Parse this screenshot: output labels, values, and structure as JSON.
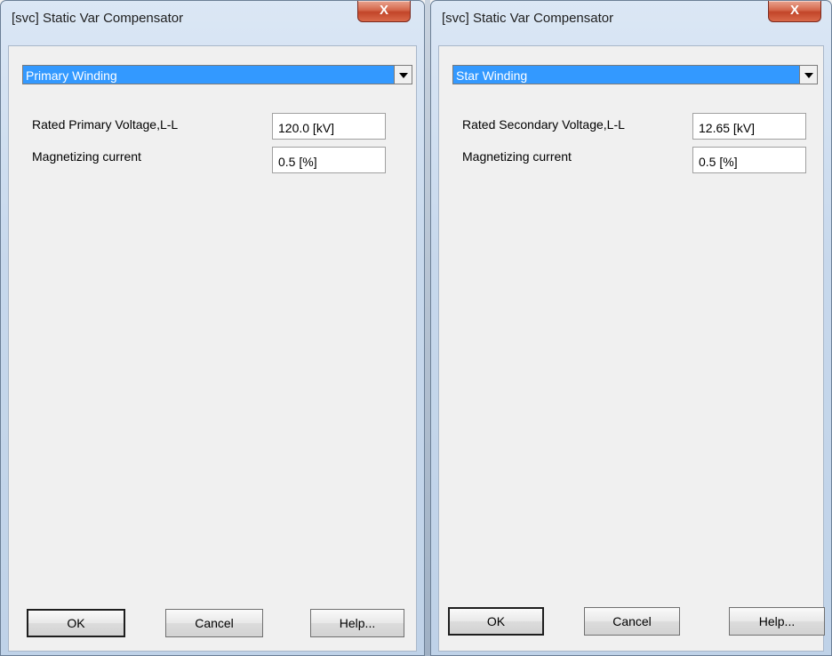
{
  "dialogs": [
    {
      "title": "[svc] Static Var Compensator",
      "close_glyph": "X",
      "section_select": "Primary Winding",
      "fields": [
        {
          "label": "Rated Primary Voltage,L-L",
          "value": "120.0 [kV]"
        },
        {
          "label": "Magnetizing current",
          "value": "0.5 [%]"
        }
      ],
      "buttons": {
        "ok": "OK",
        "cancel": "Cancel",
        "help": "Help..."
      }
    },
    {
      "title": "[svc] Static Var Compensator",
      "close_glyph": "X",
      "section_select": "Star Winding",
      "fields": [
        {
          "label": "Rated Secondary Voltage,L-L",
          "value": "12.65 [kV]"
        },
        {
          "label": "Magnetizing current",
          "value": "0.5 [%]"
        }
      ],
      "buttons": {
        "ok": "OK",
        "cancel": "Cancel",
        "help": "Help..."
      }
    }
  ],
  "colors": {
    "selection_blue": "#3399ff",
    "close_button_red": "#c24529",
    "dialog_face": "#f0f0f0",
    "frame_blue": "#c7d8ec"
  },
  "icons": {
    "close": "close-icon",
    "dropdown": "chevron-down-icon"
  }
}
